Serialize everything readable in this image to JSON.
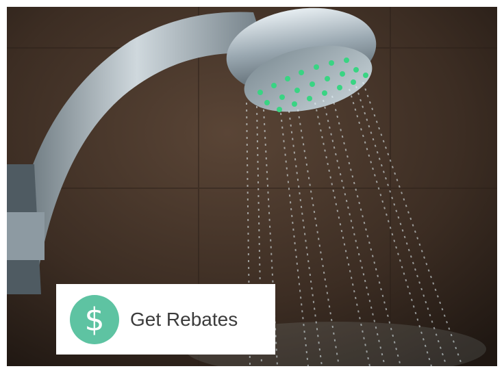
{
  "scene": {
    "description_icon": "shower-head-photo",
    "background": "#3a2c22",
    "chrome_color": "#b9c4cb",
    "nozzle_color": "#39d483",
    "water_color": "#e8f6fb"
  },
  "cta": {
    "label": "Get Rebates",
    "icon": "dollar-icon",
    "icon_glyph": "$",
    "icon_bg": "#5ec3a2"
  }
}
